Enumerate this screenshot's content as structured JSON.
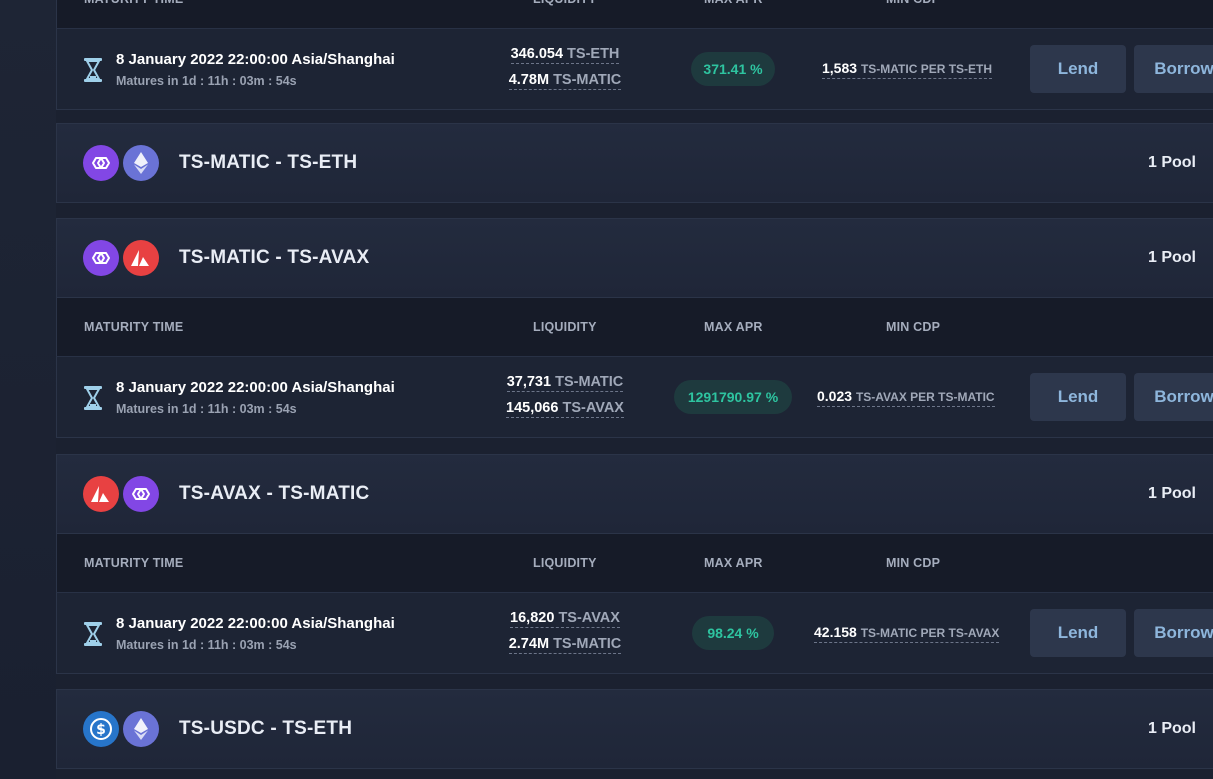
{
  "columns": {
    "maturity": "MATURITY TIME",
    "liquidity": "LIQUIDITY",
    "max_apr": "MAX APR",
    "min_cdp": "MIN CDP"
  },
  "buttons": {
    "lend": "Lend",
    "borrow": "Borrow"
  },
  "rows": [
    {
      "date": "8 January 2022 22:00:00 Asia/Shanghai",
      "matures": "Matures in 1d : 11h : 03m : 54s",
      "liq1_num": "346.054",
      "liq1_unit": "TS-ETH",
      "liq2_num": "4.78M",
      "liq2_unit": "TS-MATIC",
      "apr": "371.41 %",
      "cdp_num": "1,583",
      "cdp_unit": "TS-MATIC PER TS-ETH"
    },
    {
      "date": "8 January 2022 22:00:00 Asia/Shanghai",
      "matures": "Matures in 1d : 11h : 03m : 54s",
      "liq1_num": "37,731",
      "liq1_unit": "TS-MATIC",
      "liq2_num": "145,066",
      "liq2_unit": "TS-AVAX",
      "apr": "1291790.97 %",
      "cdp_num": "0.023",
      "cdp_unit": "TS-AVAX PER TS-MATIC"
    },
    {
      "date": "8 January 2022 22:00:00 Asia/Shanghai",
      "matures": "Matures in 1d : 11h : 03m : 54s",
      "liq1_num": "16,820",
      "liq1_unit": "TS-AVAX",
      "liq2_num": "2.74M",
      "liq2_unit": "TS-MATIC",
      "apr": "98.24 %",
      "cdp_num": "42.158",
      "cdp_unit": "TS-MATIC PER TS-AVAX"
    }
  ],
  "pairs": [
    {
      "name": "TS-MATIC - TS-ETH",
      "pools": "1 Pool",
      "icons": [
        "polygon-icon",
        "ethereum-icon"
      ]
    },
    {
      "name": "TS-MATIC - TS-AVAX",
      "pools": "1 Pool",
      "icons": [
        "polygon-icon",
        "avalanche-icon"
      ]
    },
    {
      "name": "TS-AVAX - TS-MATIC",
      "pools": "1 Pool",
      "icons": [
        "avalanche-icon",
        "polygon-icon"
      ]
    },
    {
      "name": "TS-USDC - TS-ETH",
      "pools": "1 Pool",
      "icons": [
        "usdc-icon",
        "ethereum-icon"
      ]
    }
  ],
  "colors": {
    "apr_text": "#2ec4a0",
    "button_text": "#8eb6dc",
    "matic": "#8247e5",
    "eth": "#6a73d6",
    "avax": "#e84142",
    "usdc": "#2775ca"
  }
}
